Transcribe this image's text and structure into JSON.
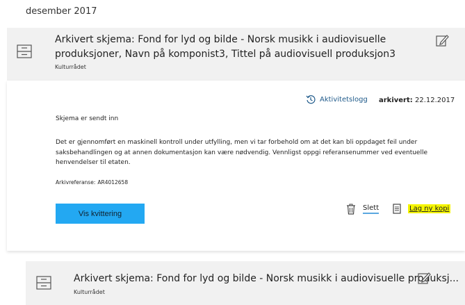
{
  "month_heading": "desember 2017",
  "card1": {
    "title": "Arkivert skjema: Fond for lyd og bilde - Norsk musikk i audiovisuelle produksjoner, Navn på komponist3, Tittel på audiovisuell produksjon3",
    "subtitle": "Kulturrådet"
  },
  "details": {
    "history_link": "Aktivitetslogg",
    "archived_label": "arkivert:",
    "archived_date": "22.12.2017",
    "sent_text": "Skjema er sendt inn",
    "description": "Det er gjennomført en maskinell kontroll under utfylling, men vi tar forbehold om at det kan bli oppdaget feil under saksbehandlingen og at annen dokumentasjon kan være nødvendig. Vennligst oppgi referansenummer ved eventuelle henvendelser til etaten.",
    "archive_ref_label": "Arkivreferanse:",
    "archive_ref_value": "AR4012658",
    "receipt_button": "Vis kvittering",
    "delete_label": "Slett",
    "copy_label": "Lag ny kopi"
  },
  "card2": {
    "title": "Arkivert skjema: Fond for lyd og bilde - Norsk musikk i audiovisuelle produksj...",
    "subtitle": "Kulturrådet"
  },
  "colors": {
    "accent_blue": "#23a8f2",
    "highlight_yellow": "#f5f500",
    "card_gray": "#f1f1f1"
  }
}
